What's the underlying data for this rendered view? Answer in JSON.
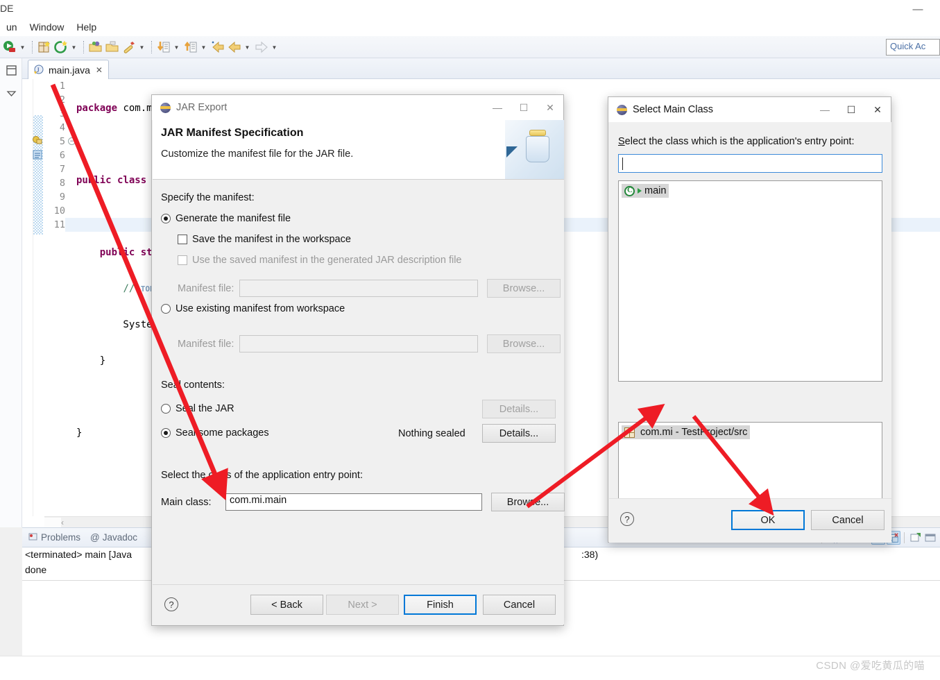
{
  "ide": {
    "window_title": "DE",
    "minimize_glyph": "—",
    "menus": [
      "un",
      "Window",
      "Help"
    ],
    "quick_access_placeholder": "Quick Ac",
    "toolbar_items": [
      {
        "name": "run-button",
        "glyph": "run"
      },
      {
        "name": "run-dropdown",
        "glyph": "▼"
      },
      {
        "name": "new-java-project-button",
        "glyph": "newproj"
      },
      {
        "name": "new-button",
        "glyph": "new"
      },
      {
        "name": "dropdown-2",
        "glyph": "▼"
      },
      {
        "name": "open-type-button",
        "glyph": "opentype"
      },
      {
        "name": "open-resource-button",
        "glyph": "openres"
      },
      {
        "name": "debug-button",
        "glyph": "debug"
      },
      {
        "name": "dropdown-3",
        "glyph": "▼"
      },
      {
        "name": "import-button",
        "glyph": "import"
      },
      {
        "name": "dropdown-4",
        "glyph": "▼"
      },
      {
        "name": "export-button",
        "glyph": "export"
      },
      {
        "name": "dropdown-5",
        "glyph": "▼"
      },
      {
        "name": "back-annotation-button",
        "glyph": "backann"
      },
      {
        "name": "back-button",
        "glyph": "back"
      },
      {
        "name": "dropdown-6",
        "glyph": "▼"
      },
      {
        "name": "forward-button",
        "glyph": "forward"
      },
      {
        "name": "dropdown-7",
        "glyph": "▼"
      }
    ],
    "editor": {
      "tab_label": "main.java",
      "tab_close_glyph": "✕",
      "line_numbers": [
        "1",
        "2",
        "3",
        "4",
        "5",
        "6",
        "7",
        "8",
        "9",
        "10",
        "11"
      ],
      "code_lines": [
        "package com.mi;",
        "",
        "public class ma",
        "",
        "    public stat",
        "        // TODO",
        "        System.",
        "    }",
        "",
        "}",
        ""
      ]
    },
    "console": {
      "tabs": [
        "Problems",
        "Javadoc"
      ],
      "line1": "<terminated> main [Java",
      "line1_tail": ":38)",
      "line2": "done",
      "scroll_chevron": "‹"
    },
    "watermark": "CSDN @爱吃黄瓜的喵"
  },
  "jar_export": {
    "title": "JAR Export",
    "minimize_glyph": "—",
    "maximize_glyph": "☐",
    "close_glyph": "✕",
    "heading": "JAR Manifest Specification",
    "subheading": "Customize the manifest file for the JAR file.",
    "specify_label": "Specify the manifest:",
    "generate_radio": "Generate the manifest file",
    "generate_selected": true,
    "save_checkbox": "Save the manifest in the workspace",
    "save_checked": false,
    "use_saved_checkbox": "Use the saved manifest in the generated JAR description file",
    "use_saved_checked": false,
    "manifest_file_label_1": "Manifest file:",
    "manifest_file_value_1": "",
    "browse_1": "Browse...",
    "use_existing_radio": "Use existing manifest from workspace",
    "use_existing_selected": false,
    "manifest_file_label_2": "Manifest file:",
    "manifest_file_value_2": "",
    "browse_2": "Browse...",
    "seal_label": "Seal contents:",
    "seal_jar_radio": "Seal the JAR",
    "seal_jar_selected": false,
    "seal_jar_details": "Details...",
    "seal_packages_radio": "Seal some packages",
    "seal_packages_selected": true,
    "nothing_sealed": "Nothing sealed",
    "seal_packages_details": "Details...",
    "entry_point_label": "Select the class of the application entry point:",
    "main_class_label": "Main class:",
    "main_class_value": "com.mi.main",
    "main_class_browse": "Browse...",
    "help_glyph": "?",
    "back_button": "< Back",
    "next_button": "Next >",
    "next_disabled": true,
    "finish_button": "Finish",
    "cancel_button": "Cancel"
  },
  "select_main_class": {
    "title": "Select Main Class",
    "minimize_glyph": "—",
    "maximize_glyph": "☐",
    "close_glyph": "✕",
    "prompt_first_letter": "S",
    "prompt_rest": "elect the class which is the application's entry point:",
    "filter_value": "",
    "class_item": "main",
    "package_item": "com.mi - TestProject/src",
    "help_glyph": "?",
    "ok_button": "OK",
    "cancel_button": "Cancel"
  },
  "colors": {
    "accent_blue": "#0078d7",
    "annotation_red": "#ee1c25",
    "keyword_purple": "#7f0055",
    "comment_green": "#3f7f5f"
  }
}
